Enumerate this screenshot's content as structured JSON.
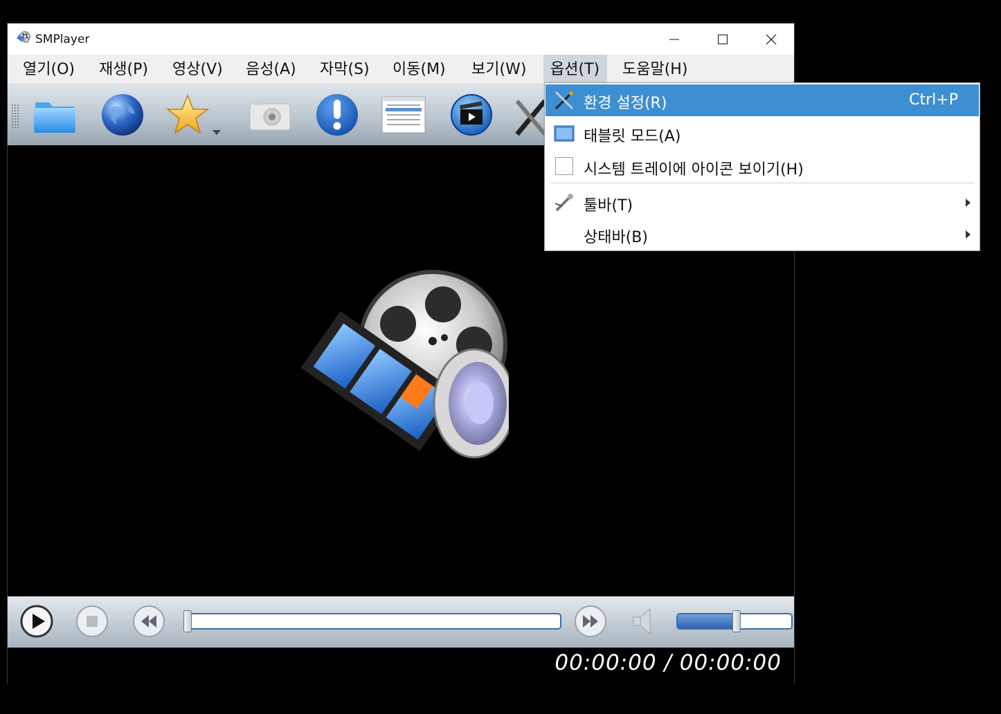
{
  "window": {
    "title": "SMPlayer",
    "controls": {
      "minimize": "minimize-icon",
      "maximize": "maximize-icon",
      "close": "close-icon"
    }
  },
  "menubar": {
    "items": [
      {
        "label": "열기(O)"
      },
      {
        "label": "재생(P)"
      },
      {
        "label": "영상(V)"
      },
      {
        "label": "음성(A)"
      },
      {
        "label": "자막(S)"
      },
      {
        "label": "이동(M)"
      },
      {
        "label": "보기(W)"
      },
      {
        "label": "옵션(T)",
        "active": true
      },
      {
        "label": "도움말(H)"
      }
    ]
  },
  "toolbar": {
    "icons": [
      "open-folder-icon",
      "globe-icon",
      "favorites-star-icon",
      "screenshot-camera-icon",
      "info-icon",
      "playlist-icon",
      "video-clapper-icon",
      "preferences-tools-icon"
    ]
  },
  "options_menu": {
    "items": [
      {
        "label": "환경 설정(R)",
        "shortcut": "Ctrl+P",
        "icon": "preferences-icon",
        "highlighted": true
      },
      {
        "label": "태블릿 모드(A)",
        "icon": "tablet-mode-icon"
      },
      {
        "label": "시스템 트레이에 아이콘 보이기(H)",
        "icon": "checkbox-icon",
        "checked": false
      },
      {
        "label": "툴바(T)",
        "icon": "toolbar-icon",
        "submenu": true
      },
      {
        "label": "상태바(B)",
        "submenu": true
      }
    ]
  },
  "player": {
    "time": "00:00:00 / 00:00:00",
    "seek_progress": 0,
    "volume_level": 0.52
  },
  "colors": {
    "menu_highlight": "#3d8fd1",
    "seek_border": "#3b6ea8"
  }
}
